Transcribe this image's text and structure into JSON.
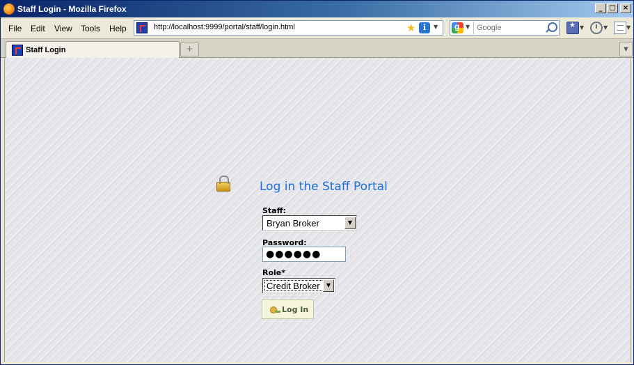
{
  "window": {
    "title": "Staff Login - Mozilla Firefox"
  },
  "menu": {
    "file": "File",
    "edit": "Edit",
    "view": "View",
    "tools": "Tools",
    "help": "Help"
  },
  "address_bar": {
    "url": "http://localhost:9999/portal/staff/login.html"
  },
  "search": {
    "placeholder": "Google"
  },
  "tabs": [
    {
      "label": "Staff Login",
      "active": true
    }
  ],
  "login": {
    "heading": "Log in the Staff Portal",
    "staff_label": "Staff:",
    "staff_value": "Bryan Broker",
    "password_label": "Password:",
    "password_mask": "●●●●●●",
    "role_label": "Role*",
    "role_value": "Credit Broker",
    "button_label": "Log In"
  },
  "colors": {
    "heading": "#1e6fd9",
    "button_bg": "#f5f5dc",
    "title_bar": "#0a246a"
  }
}
